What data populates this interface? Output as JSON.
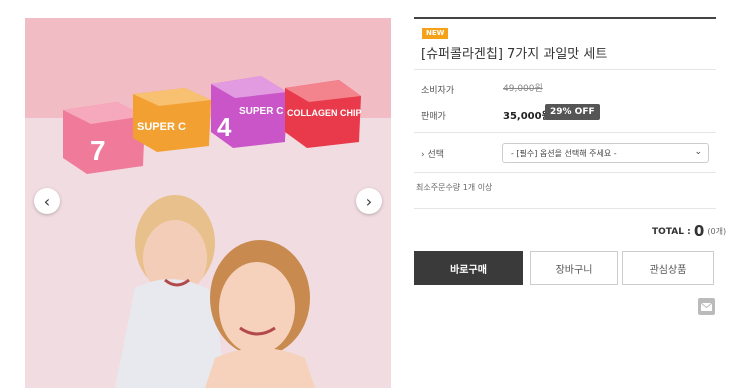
{
  "gallery": {
    "prev_icon": "chevron-left-icon",
    "next_icon": "chevron-right-icon",
    "box_labels": [
      "7",
      "SUPER C",
      "4",
      "SUPER C",
      "COLLAGEN CHIP"
    ]
  },
  "product": {
    "badge": "NEW",
    "title": "[슈퍼콜라겐칩] 7가지 과일맛 세트",
    "consumer_price_label": "소비자가",
    "consumer_price": "49,000원",
    "sale_price_label": "판매가",
    "sale_price": "35,000원",
    "discount": "29% OFF",
    "option_label": "› 선택",
    "option_placeholder": "- [필수] 옵션을 선택해 주세요 -",
    "min_order": "최소주문수량 1개 이상",
    "total_label": "TOTAL :",
    "total_value": "0",
    "total_count": "(0개)"
  },
  "actions": {
    "buy_now": "바로구매",
    "cart": "장바구니",
    "wishlist": "관심상품"
  },
  "colors": {
    "accent_badge": "#f5a11a",
    "buy_button": "#3a3a3a",
    "gallery_bg": "#f1dde1"
  }
}
